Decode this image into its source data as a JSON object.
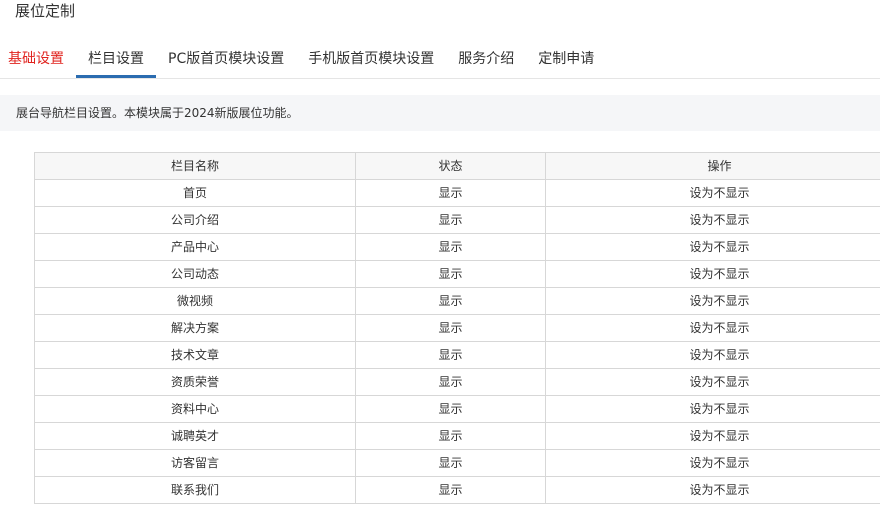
{
  "page": {
    "title": "展位定制"
  },
  "tabs": [
    {
      "label": "基础设置"
    },
    {
      "label": "栏目设置"
    },
    {
      "label": "PC版首页模块设置"
    },
    {
      "label": "手机版首页模块设置"
    },
    {
      "label": "服务介绍"
    },
    {
      "label": "定制申请"
    }
  ],
  "notice": {
    "text": "展台导航栏目设置。本模块属于2024新版展位功能。"
  },
  "table": {
    "headers": {
      "name": "栏目名称",
      "status": "状态",
      "action": "操作"
    },
    "rows": [
      {
        "name": "首页",
        "status": "显示",
        "action": "设为不显示"
      },
      {
        "name": "公司介绍",
        "status": "显示",
        "action": "设为不显示"
      },
      {
        "name": "产品中心",
        "status": "显示",
        "action": "设为不显示"
      },
      {
        "name": "公司动态",
        "status": "显示",
        "action": "设为不显示"
      },
      {
        "name": "微视频",
        "status": "显示",
        "action": "设为不显示"
      },
      {
        "name": "解决方案",
        "status": "显示",
        "action": "设为不显示"
      },
      {
        "name": "技术文章",
        "status": "显示",
        "action": "设为不显示"
      },
      {
        "name": "资质荣誉",
        "status": "显示",
        "action": "设为不显示"
      },
      {
        "name": "资料中心",
        "status": "显示",
        "action": "设为不显示"
      },
      {
        "name": "诚聘英才",
        "status": "显示",
        "action": "设为不显示"
      },
      {
        "name": "访客留言",
        "status": "显示",
        "action": "设为不显示"
      },
      {
        "name": "联系我们",
        "status": "显示",
        "action": "设为不显示"
      }
    ]
  },
  "colors": {
    "active_tab": "#e0241f",
    "tab_underline": "#2b6cb0",
    "notice_bg": "#f5f6f8",
    "border": "#d7d7d7"
  }
}
